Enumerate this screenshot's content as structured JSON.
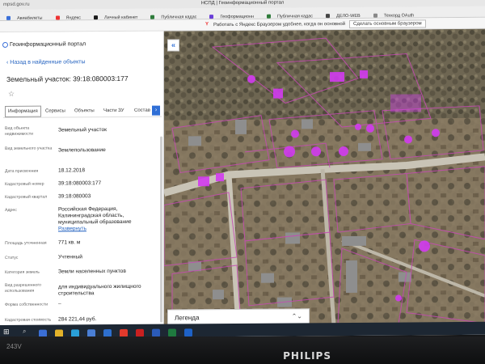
{
  "browser": {
    "address": "mpsd.gov.ru",
    "window_title": "НСПД | Геоинформационный портал",
    "bookmarks": [
      {
        "label": "Авиабилеты",
        "color": "#3a6fd8"
      },
      {
        "label": "Яндекс",
        "color": "#e33"
      },
      {
        "label": "Личный кабинет",
        "color": "#1a1a1a"
      },
      {
        "label": "Публичная кадас",
        "color": "#2f7c3b"
      },
      {
        "label": "Геоформационн",
        "color": "#6a3fd8"
      },
      {
        "label": "Публичная кадас",
        "color": "#2f7c3b"
      },
      {
        "label": "ДЕЛО-WEB",
        "color": "#444"
      },
      {
        "label": "Техкорд OAuth",
        "color": "#888"
      }
    ],
    "yandex_bar": {
      "logo": "Y",
      "message": "Работать с Яндекс Браузером удобнее, когда он основной",
      "button": "Сделать основным браузером"
    }
  },
  "panel": {
    "portal_name": "Геоинформационный портал",
    "back_label": "Назад в найденные объекты",
    "title": "Земельный участок: 39:18:080003:177",
    "star_icon": "☆",
    "tabs": [
      "Информация",
      "Сервисы",
      "Объекты",
      "Части ЗУ",
      "Состав"
    ],
    "tab_arrow": "›",
    "rows": [
      {
        "label": "Вид объекта недвижимости",
        "value": "Земельный участок"
      },
      {
        "label": "Вид земельного участка",
        "value": "Землепользование"
      },
      {
        "label": "Дата присвоения",
        "value": "18.12.2018"
      },
      {
        "label": "Кадастровый номер",
        "value": "39:18:080003:177"
      },
      {
        "label": "Кадастровый квартал",
        "value": "39:18:080003"
      },
      {
        "label": "Адрес",
        "value": "Российская Федерация, Калининградская область, муниципальный образование",
        "link": "Развернуть"
      },
      {
        "label": "Площадь уточненная",
        "value": "771 кв. м"
      },
      {
        "label": "Статус",
        "value": "Учтенный"
      },
      {
        "label": "Категория земель",
        "value": "Земли населенных пунктов"
      },
      {
        "label": "Вид разрешенного использования",
        "value": "для индивидуального жилищного строительства"
      },
      {
        "label": "Форма собственности",
        "value": "–"
      },
      {
        "label": "Кадастровая стоимость",
        "value": "284 221,44 руб."
      }
    ]
  },
  "map": {
    "collapse_icon": "«",
    "legend_label": "Легенда",
    "legend_chevron": "⌃⌄",
    "highlight_color": "#d23bf0",
    "boundary_color": "#c64ab4"
  },
  "taskbar": {
    "start_icon": "⊞",
    "search_icon": "⌕",
    "apps": [
      {
        "name": "task-view-icon",
        "color": "#3b6fd6"
      },
      {
        "name": "chrome-icon",
        "color": "#e4b32a"
      },
      {
        "name": "edge-icon",
        "color": "#2aa0d8"
      },
      {
        "name": "store-icon",
        "color": "#4a7fd6"
      },
      {
        "name": "mail-icon",
        "color": "#2e6fce"
      },
      {
        "name": "yandex-icon",
        "color": "#e23a2c"
      },
      {
        "name": "pdf-icon",
        "color": "#c92020"
      },
      {
        "name": "word-icon",
        "color": "#2b5bb8"
      },
      {
        "name": "excel-icon",
        "color": "#1f7a3f"
      },
      {
        "name": "outlook-icon",
        "color": "#1e62c7"
      }
    ]
  },
  "monitor": {
    "brand": "PHILIPS",
    "model_label": "243V"
  }
}
